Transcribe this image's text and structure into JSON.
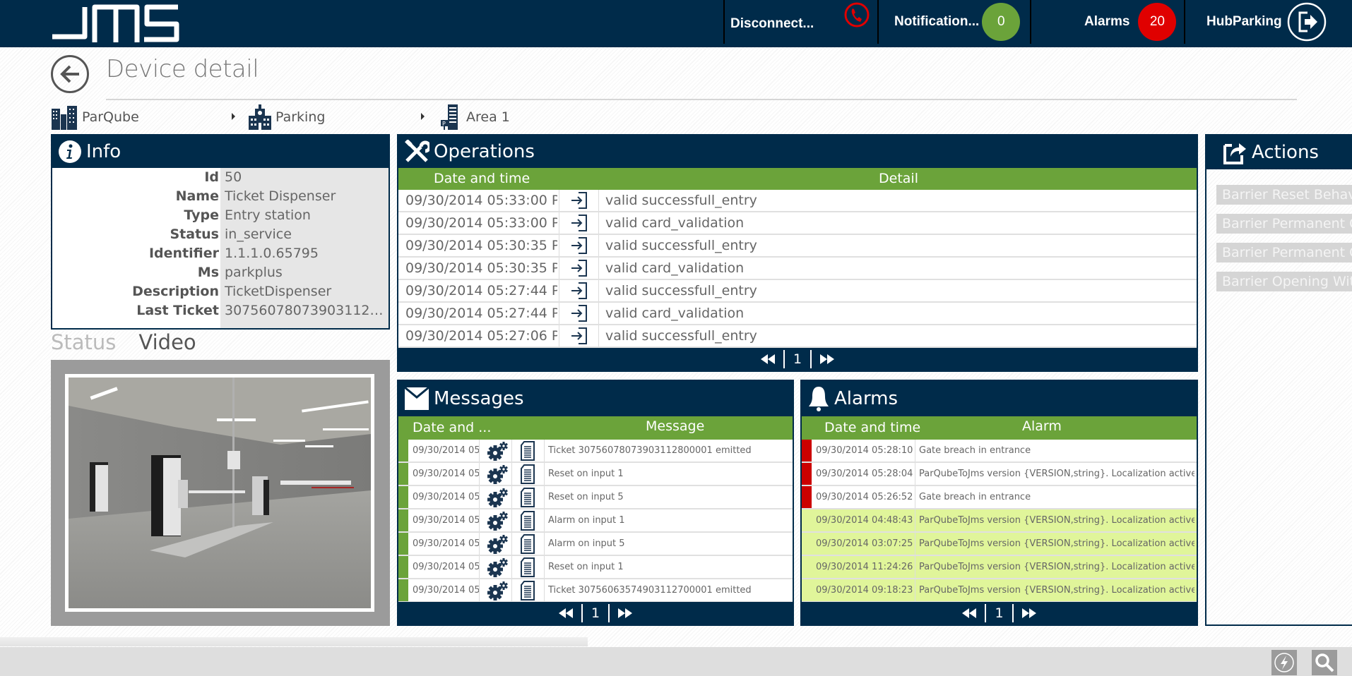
{
  "header": {
    "logo": "JMS",
    "connection": {
      "label": "Disconnect...",
      "icon": "phone-disconnected-icon",
      "color": "#e00000"
    },
    "notifications": {
      "label": "Notification...",
      "count": "0",
      "color": "#6ba33a"
    },
    "alarms": {
      "label": "Alarms",
      "count": "20",
      "color": "#e00000"
    },
    "user": {
      "label": "HubParking",
      "icon": "logout-icon"
    }
  },
  "page": {
    "title": "Device detail",
    "back_icon": "back-arrow-icon"
  },
  "breadcrumb": [
    {
      "label": "ParQube",
      "icon": "buildings-icon"
    },
    {
      "label": "Parking",
      "icon": "school-building-icon"
    },
    {
      "label": "Area 1",
      "icon": "parking-tower-icon"
    }
  ],
  "info": {
    "title": "Info",
    "rows": [
      {
        "key": "Id",
        "value": "50"
      },
      {
        "key": "Name",
        "value": "Ticket Dispenser"
      },
      {
        "key": "Type",
        "value": "Entry station"
      },
      {
        "key": "Status",
        "value": "in_service"
      },
      {
        "key": "Identifier",
        "value": "1.1.1.0.65795"
      },
      {
        "key": "Ms",
        "value": "parkplus"
      },
      {
        "key": "Description",
        "value": "TicketDispenser"
      },
      {
        "key": "Last Ticket",
        "value": "30756078073903112800.."
      }
    ]
  },
  "tabs": {
    "status": "Status",
    "video": "Video",
    "active": "Video"
  },
  "video": {
    "alt": "Parking garage entry with ticket dispensers and barriers"
  },
  "operations": {
    "title": "Operations",
    "columns": [
      "Date and time",
      "Detail"
    ],
    "rows": [
      {
        "datetime": "09/30/2014 05:33:00 P...",
        "icon": "entry-icon",
        "detail": "valid successfull_entry"
      },
      {
        "datetime": "09/30/2014 05:33:00 P...",
        "icon": "entry-icon",
        "detail": "valid card_validation"
      },
      {
        "datetime": "09/30/2014 05:30:35 P...",
        "icon": "entry-icon",
        "detail": "valid successfull_entry"
      },
      {
        "datetime": "09/30/2014 05:30:35 P...",
        "icon": "entry-icon",
        "detail": "valid card_validation"
      },
      {
        "datetime": "09/30/2014 05:27:44 P...",
        "icon": "entry-icon",
        "detail": "valid successfull_entry"
      },
      {
        "datetime": "09/30/2014 05:27:44 P...",
        "icon": "entry-icon",
        "detail": "valid card_validation"
      },
      {
        "datetime": "09/30/2014 05:27:06 P...",
        "icon": "entry-icon",
        "detail": "valid successfull_entry"
      }
    ],
    "page": "1"
  },
  "messages": {
    "title": "Messages",
    "columns": [
      "Date and ...",
      "Message"
    ],
    "rows": [
      {
        "datetime": "09/30/2014 05..",
        "message": "Ticket 30756078073903112800001 emitted"
      },
      {
        "datetime": "09/30/2014 05..",
        "message": "Reset on input 1"
      },
      {
        "datetime": "09/30/2014 05..",
        "message": "Reset on input 5"
      },
      {
        "datetime": "09/30/2014 05..",
        "message": "Alarm on input 1"
      },
      {
        "datetime": "09/30/2014 05..",
        "message": "Alarm on input 5"
      },
      {
        "datetime": "09/30/2014 05..",
        "message": "Reset on input 1"
      },
      {
        "datetime": "09/30/2014 05..",
        "message": "Ticket 30756063574903112700001 emitted"
      }
    ],
    "status_color": "#6ba33a",
    "page": "1"
  },
  "alarms": {
    "title": "Alarms",
    "columns": [
      "Date and time",
      "Alarm"
    ],
    "rows": [
      {
        "datetime": "09/30/2014 05:28:10 P...",
        "alarm": "Gate breach in entrance",
        "state": "active"
      },
      {
        "datetime": "09/30/2014 05:28:04 P...",
        "alarm": "ParQubeToJms version {VERSION,string}. Localization active!",
        "state": "active"
      },
      {
        "datetime": "09/30/2014 05:26:52 P...",
        "alarm": "Gate breach in entrance",
        "state": "active"
      },
      {
        "datetime": "09/30/2014 04:48:43 P...",
        "alarm": "ParQubeToJms version {VERSION,string}. Localization active!",
        "state": "resolved"
      },
      {
        "datetime": "09/30/2014 03:07:25 P...",
        "alarm": "ParQubeToJms version {VERSION,string}. Localization active!",
        "state": "resolved"
      },
      {
        "datetime": "09/30/2014 11:24:26 A...",
        "alarm": "ParQubeToJms version {VERSION,string}. Localization active!",
        "state": "resolved"
      },
      {
        "datetime": "09/30/2014 09:18:23 A...",
        "alarm": "ParQubeToJms version {VERSION,string}. Localization active!",
        "state": "resolved"
      }
    ],
    "colors": {
      "active": "#cc0000",
      "resolved_bg": "#e0f59a"
    },
    "page": "1"
  },
  "actions": {
    "title": "Actions",
    "buttons": [
      "Barrier Reset Behavior",
      "Barrier Permanent Open",
      "Barrier Permanent Close",
      "Barrier Opening Without"
    ]
  },
  "bottom_bar": {
    "icons": [
      "flash-icon",
      "search-icon"
    ]
  }
}
